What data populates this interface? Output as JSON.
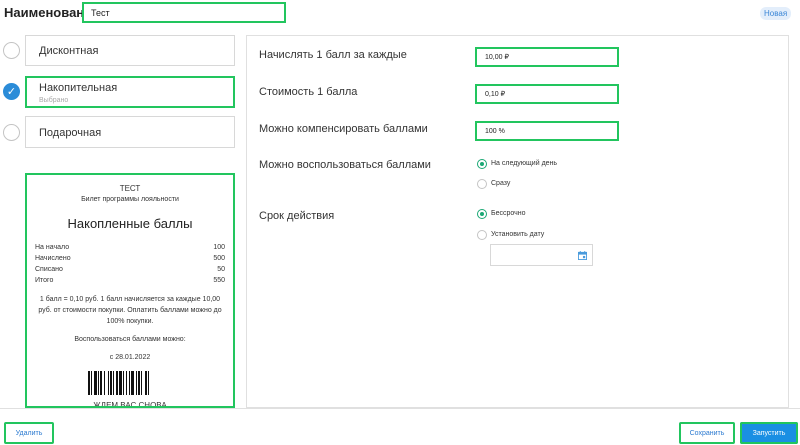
{
  "header": {
    "name_label": "Наименование",
    "name_value": "Тест",
    "status_badge": "Новая"
  },
  "types": [
    {
      "title": "Дисконтная",
      "subtitle": "",
      "selected": false
    },
    {
      "title": "Накопительная",
      "subtitle": "Выбрано",
      "selected": true
    },
    {
      "title": "Подарочная",
      "subtitle": "",
      "selected": false
    }
  ],
  "ticket": {
    "name": "ТЕСТ",
    "subtitle": "Билет программы лояльности",
    "heading": "Накопленные баллы",
    "rows": [
      {
        "label": "На начало",
        "value": "100"
      },
      {
        "label": "Начислено",
        "value": "500"
      },
      {
        "label": "Списано",
        "value": "50"
      },
      {
        "label": "Итого",
        "value": "550"
      }
    ],
    "description": "1 балл = 0,10 руб. 1 балл начисляется за каждые 10,00 руб. от стоимости покупки. Оплатить баллами можно до 100% покупки.",
    "use_label": "Воспользоваться баллами можно:",
    "use_date": "с 28.01.2022",
    "footer": "ЖДЕМ ВАС СНОВА"
  },
  "settings": {
    "accrual_label": "Начислять 1 балл за каждые",
    "accrual_value": "10,00 ₽",
    "cost_label": "Стоимость 1 балла",
    "cost_value": "0,10 ₽",
    "compensate_label": "Можно компенсировать баллами",
    "compensate_value": "100 %",
    "use_label": "Можно воспользоваться баллами",
    "use_options": [
      {
        "label": "На следующий день",
        "selected": true
      },
      {
        "label": "Сразу",
        "selected": false
      }
    ],
    "validity_label": "Срок действия",
    "validity_options": [
      {
        "label": "Бессрочно",
        "selected": true
      },
      {
        "label": "Установить дату",
        "selected": false
      }
    ],
    "date_value": ""
  },
  "footer": {
    "delete_label": "Удалить",
    "save_label": "Сохранить",
    "run_label": "Запустить"
  },
  "colors": {
    "accent_blue": "#1a8fe3",
    "radio_green": "#1aa874",
    "highlight": "#22c55e"
  },
  "icons": [
    "check-icon",
    "calendar-icon",
    "barcode"
  ]
}
